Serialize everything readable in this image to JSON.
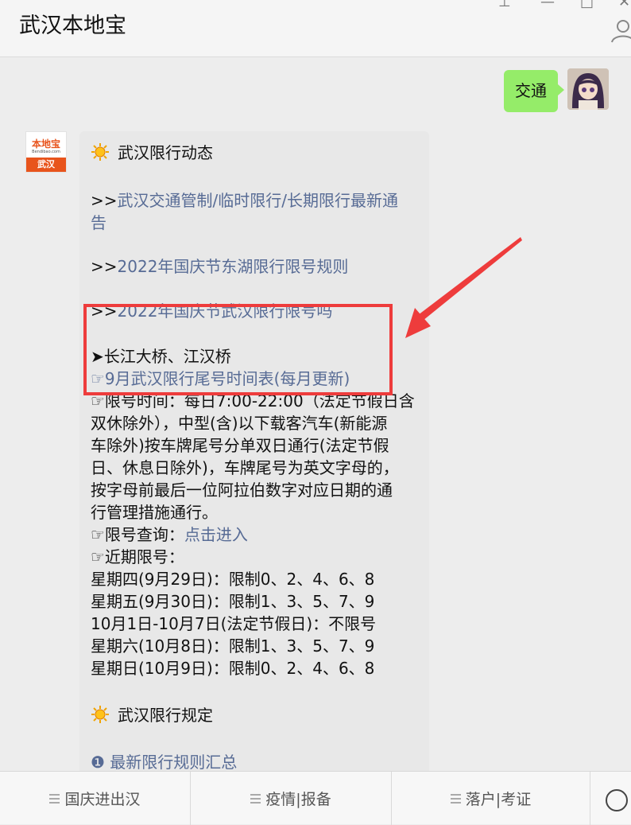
{
  "header": {
    "title": "武汉本地宝"
  },
  "chat": {
    "user_message": "交通",
    "bot_logo": {
      "brand": "本地宝",
      "url": "Bendibao.com",
      "city": "武汉"
    },
    "bot_message": {
      "section1_title": "武汉限行动态",
      "link_prefix": ">>",
      "link1_line1": "武汉交通管制/临时限行/长期限行最新通",
      "link1_line2": "告",
      "link2": "2022年国庆节东湖限行限号规则",
      "link3": "2022年国庆节武汉限行限号吗",
      "bridge_line": "➤长江大桥、江汉桥",
      "schedule_link": "☞9月武汉限行尾号时间表(每月更新)",
      "rule_lines": [
        "☞限号时间：每日7:00-22:00（法定节假日含",
        "双休除外），中型(含)以下载客汽车(新能源",
        "车除外)按车牌尾号分单双日通行(法定节假",
        "日、休息日除外)，车牌尾号为英文字母的，",
        "按字母前最后一位阿拉伯数字对应日期的通",
        "行管理措施通行。"
      ],
      "query_label": "☞限号查询：",
      "query_link": "点击进入",
      "recent_label": "☞近期限号：",
      "recent_lines": [
        "星期四(9月29日)：限制0、2、4、6、8",
        "星期五(9月30日)：限制1、3、5、7、9",
        "10月1日-10月7日(法定节假日)：不限号",
        "星期六(10月8日)：限制1、3、5、7、9",
        "星期日(10月9日)：限制0、2、4、6、8"
      ],
      "section2_title": "武汉限行规定",
      "bullet_link": "❶ 最新限行规则汇总"
    }
  },
  "tabbar": {
    "tabs": [
      "国庆进出汉",
      "疫情|报备",
      "落户|考证"
    ]
  },
  "colors": {
    "accent_link": "#576b95",
    "user_bubble": "#95ec69",
    "highlight": "#ee3c3c"
  }
}
